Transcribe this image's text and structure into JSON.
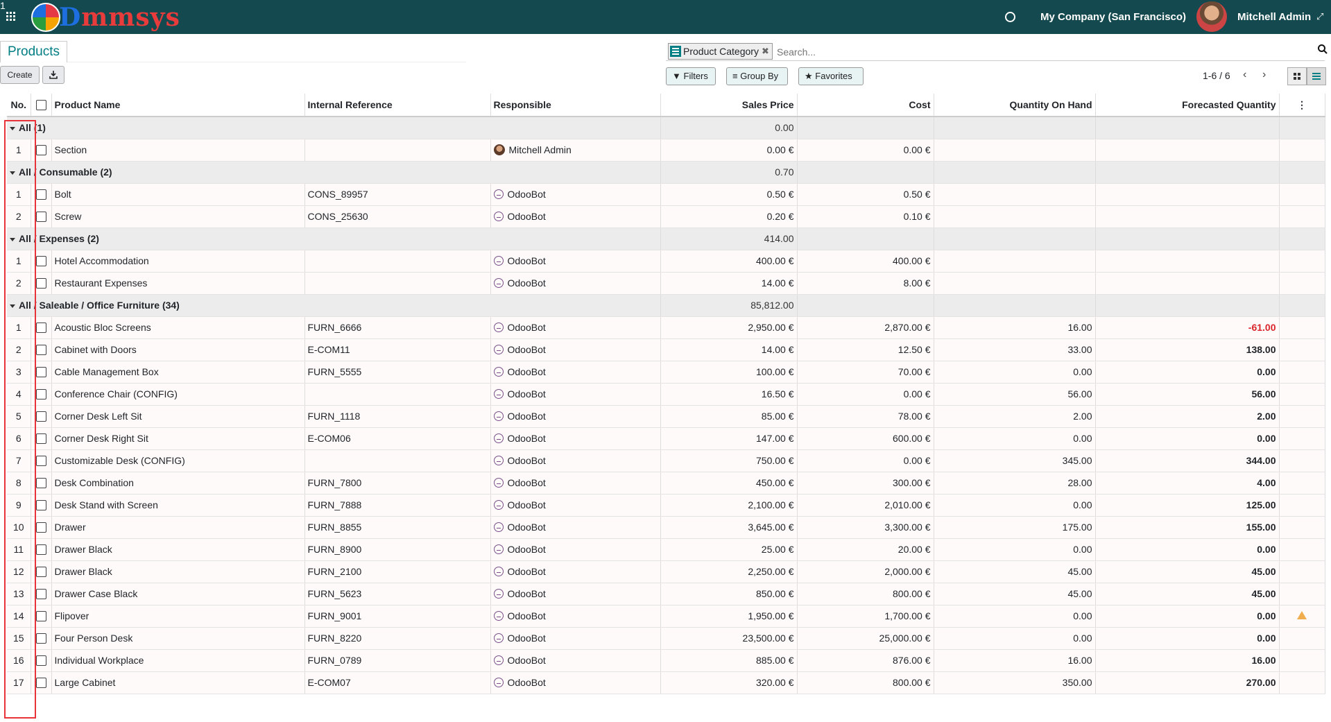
{
  "app": {
    "logo_text": "Dmmsys",
    "activity_count": "1",
    "company": "My Company (San Francisco)",
    "user": "Mitchell Admin"
  },
  "control": {
    "breadcrumb": "Products",
    "create_label": "Create",
    "search_facet": "Product Category",
    "search_placeholder": "Search...",
    "filters_label": "Filters",
    "groupby_label": "Group By",
    "favorites_label": "Favorites",
    "pager": "1-6 / 6"
  },
  "columns": [
    "No.",
    "Product Name",
    "Internal Reference",
    "Responsible",
    "Sales Price",
    "Cost",
    "Quantity On Hand",
    "Forecasted Quantity"
  ],
  "groups": [
    {
      "label": "All (1)",
      "sum": "0.00",
      "rows": [
        {
          "no": "1",
          "name": "Section",
          "ref": "",
          "resp": "Mitchell Admin",
          "resp_type": "admin",
          "price": "0.00 €",
          "cost": "0.00 €",
          "qty": "",
          "forecast": "",
          "forecast_style": ""
        }
      ]
    },
    {
      "label": "All / Consumable (2)",
      "sum": "0.70",
      "rows": [
        {
          "no": "1",
          "name": "Bolt",
          "ref": "CONS_89957",
          "resp": "OdooBot",
          "resp_type": "bot",
          "price": "0.50 €",
          "cost": "0.50 €",
          "qty": "",
          "forecast": "",
          "forecast_style": ""
        },
        {
          "no": "2",
          "name": "Screw",
          "ref": "CONS_25630",
          "resp": "OdooBot",
          "resp_type": "bot",
          "price": "0.20 €",
          "cost": "0.10 €",
          "qty": "",
          "forecast": "",
          "forecast_style": ""
        }
      ]
    },
    {
      "label": "All / Expenses (2)",
      "sum": "414.00",
      "rows": [
        {
          "no": "1",
          "name": "Hotel Accommodation",
          "ref": "",
          "resp": "OdooBot",
          "resp_type": "bot",
          "price": "400.00 €",
          "cost": "400.00 €",
          "qty": "",
          "forecast": "",
          "forecast_style": ""
        },
        {
          "no": "2",
          "name": "Restaurant Expenses",
          "ref": "",
          "resp": "OdooBot",
          "resp_type": "bot",
          "price": "14.00 €",
          "cost": "8.00 €",
          "qty": "",
          "forecast": "",
          "forecast_style": ""
        }
      ]
    },
    {
      "label": "All / Saleable / Office Furniture (34)",
      "sum": "85,812.00",
      "rows": [
        {
          "no": "1",
          "name": "Acoustic Bloc Screens",
          "ref": "FURN_6666",
          "resp": "OdooBot",
          "resp_type": "bot",
          "price": "2,950.00 €",
          "cost": "2,870.00 €",
          "qty": "16.00",
          "forecast": "-61.00",
          "forecast_style": "neg"
        },
        {
          "no": "2",
          "name": "Cabinet with Doors",
          "ref": "E-COM11",
          "resp": "OdooBot",
          "resp_type": "bot",
          "price": "14.00 €",
          "cost": "12.50 €",
          "qty": "33.00",
          "forecast": "138.00",
          "forecast_style": "bold"
        },
        {
          "no": "3",
          "name": "Cable Management Box",
          "ref": "FURN_5555",
          "resp": "OdooBot",
          "resp_type": "bot",
          "price": "100.00 €",
          "cost": "70.00 €",
          "qty": "0.00",
          "forecast": "0.00",
          "forecast_style": "bold"
        },
        {
          "no": "4",
          "name": "Conference Chair (CONFIG)",
          "ref": "",
          "resp": "OdooBot",
          "resp_type": "bot",
          "price": "16.50 €",
          "cost": "0.00 €",
          "qty": "56.00",
          "forecast": "56.00",
          "forecast_style": "bold"
        },
        {
          "no": "5",
          "name": "Corner Desk Left Sit",
          "ref": "FURN_1118",
          "resp": "OdooBot",
          "resp_type": "bot",
          "price": "85.00 €",
          "cost": "78.00 €",
          "qty": "2.00",
          "forecast": "2.00",
          "forecast_style": "bold"
        },
        {
          "no": "6",
          "name": "Corner Desk Right Sit",
          "ref": "E-COM06",
          "resp": "OdooBot",
          "resp_type": "bot",
          "price": "147.00 €",
          "cost": "600.00 €",
          "qty": "0.00",
          "forecast": "0.00",
          "forecast_style": "bold"
        },
        {
          "no": "7",
          "name": "Customizable Desk (CONFIG)",
          "ref": "",
          "resp": "OdooBot",
          "resp_type": "bot",
          "price": "750.00 €",
          "cost": "0.00 €",
          "qty": "345.00",
          "forecast": "344.00",
          "forecast_style": "bold"
        },
        {
          "no": "8",
          "name": "Desk Combination",
          "ref": "FURN_7800",
          "resp": "OdooBot",
          "resp_type": "bot",
          "price": "450.00 €",
          "cost": "300.00 €",
          "qty": "28.00",
          "forecast": "4.00",
          "forecast_style": "bold"
        },
        {
          "no": "9",
          "name": "Desk Stand with Screen",
          "ref": "FURN_7888",
          "resp": "OdooBot",
          "resp_type": "bot",
          "price": "2,100.00 €",
          "cost": "2,010.00 €",
          "qty": "0.00",
          "forecast": "125.00",
          "forecast_style": "bold"
        },
        {
          "no": "10",
          "name": "Drawer",
          "ref": "FURN_8855",
          "resp": "OdooBot",
          "resp_type": "bot",
          "price": "3,645.00 €",
          "cost": "3,300.00 €",
          "qty": "175.00",
          "forecast": "155.00",
          "forecast_style": "bold"
        },
        {
          "no": "11",
          "name": "Drawer Black",
          "ref": "FURN_8900",
          "resp": "OdooBot",
          "resp_type": "bot",
          "price": "25.00 €",
          "cost": "20.00 €",
          "qty": "0.00",
          "forecast": "0.00",
          "forecast_style": "bold"
        },
        {
          "no": "12",
          "name": "Drawer Black",
          "ref": "FURN_2100",
          "resp": "OdooBot",
          "resp_type": "bot",
          "price": "2,250.00 €",
          "cost": "2,000.00 €",
          "qty": "45.00",
          "forecast": "45.00",
          "forecast_style": "bold"
        },
        {
          "no": "13",
          "name": "Drawer Case Black",
          "ref": "FURN_5623",
          "resp": "OdooBot",
          "resp_type": "bot",
          "price": "850.00 €",
          "cost": "800.00 €",
          "qty": "45.00",
          "forecast": "45.00",
          "forecast_style": "bold"
        },
        {
          "no": "14",
          "name": "Flipover",
          "ref": "FURN_9001",
          "resp": "OdooBot",
          "resp_type": "bot",
          "price": "1,950.00 €",
          "cost": "1,700.00 €",
          "qty": "0.00",
          "forecast": "0.00",
          "forecast_style": "bold",
          "warning": true
        },
        {
          "no": "15",
          "name": "Four Person Desk",
          "ref": "FURN_8220",
          "resp": "OdooBot",
          "resp_type": "bot",
          "price": "23,500.00 €",
          "cost": "25,000.00 €",
          "qty": "0.00",
          "forecast": "0.00",
          "forecast_style": "bold"
        },
        {
          "no": "16",
          "name": "Individual Workplace",
          "ref": "FURN_0789",
          "resp": "OdooBot",
          "resp_type": "bot",
          "price": "885.00 €",
          "cost": "876.00 €",
          "qty": "16.00",
          "forecast": "16.00",
          "forecast_style": "bold"
        },
        {
          "no": "17",
          "name": "Large Cabinet",
          "ref": "E-COM07",
          "resp": "OdooBot",
          "resp_type": "bot",
          "price": "320.00 €",
          "cost": "800.00 €",
          "qty": "350.00",
          "forecast": "270.00",
          "forecast_style": "bold"
        }
      ]
    }
  ]
}
